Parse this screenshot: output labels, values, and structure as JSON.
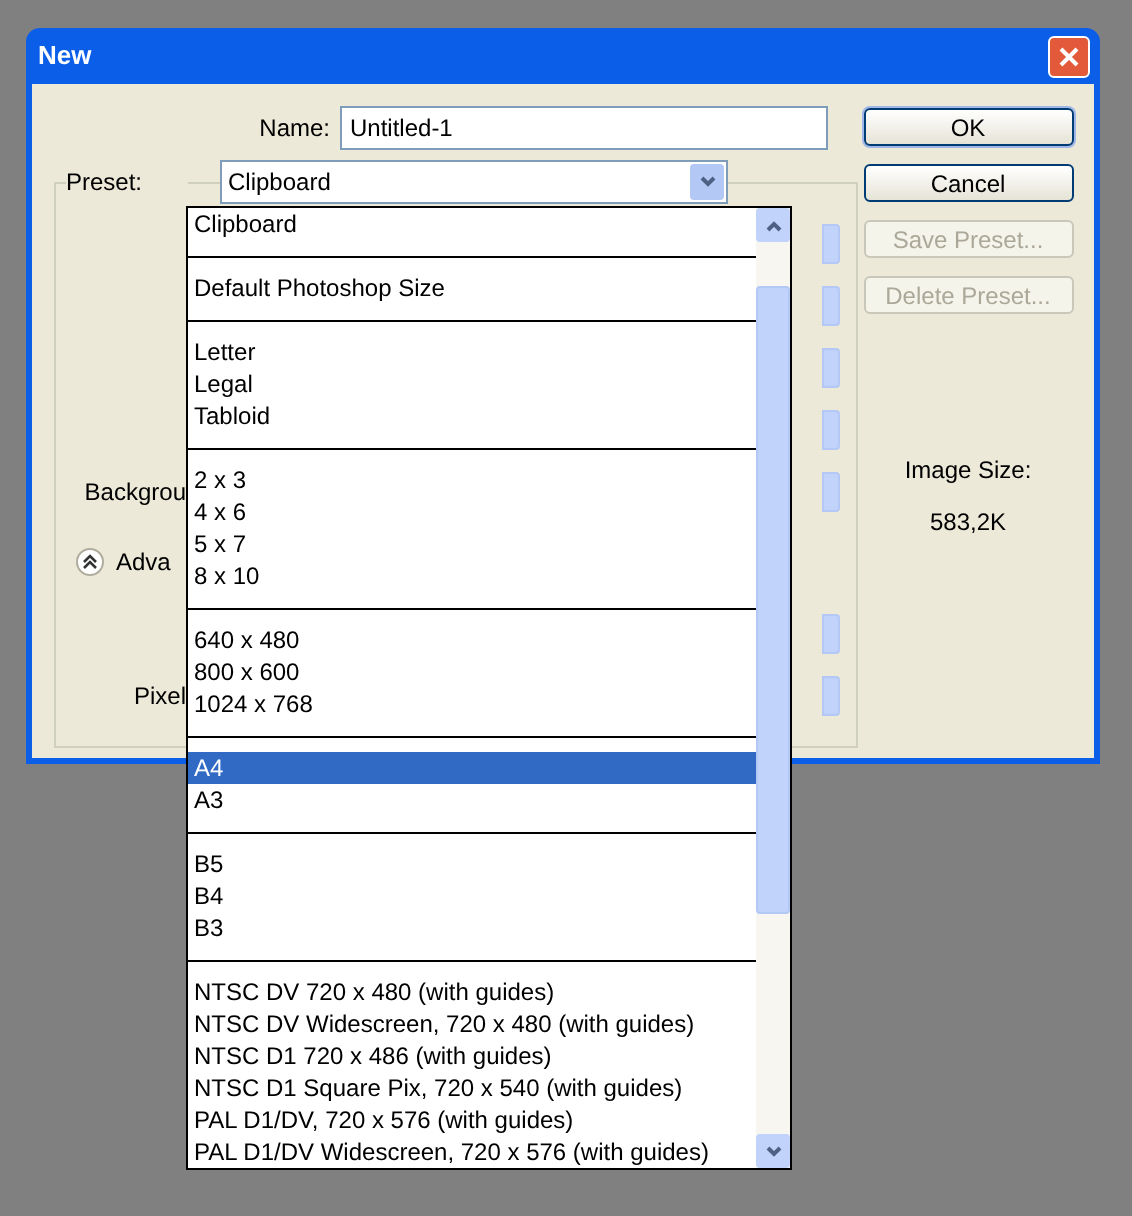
{
  "window": {
    "title": "New"
  },
  "name_field": {
    "label": "Name:",
    "value": "Untitled-1"
  },
  "preset": {
    "label": "Preset:",
    "value": "Clipboard",
    "expanded": true
  },
  "settings_rows": [
    {
      "kind": "dropdown"
    },
    {
      "kind": "dropdown"
    },
    {
      "kind": "dropdown"
    },
    {
      "kind": "dropdown"
    },
    {
      "kind": "dropdown",
      "label": "Backgrou"
    },
    {
      "kind": "advanced",
      "label": "Adva"
    },
    {
      "kind": "dropdown"
    },
    {
      "kind": "dropdown",
      "label": "Pixel"
    }
  ],
  "buttons": [
    {
      "label": "OK",
      "disabled": false,
      "default": true
    },
    {
      "label": "Cancel",
      "disabled": false,
      "default": false
    },
    {
      "label": "Save Preset...",
      "disabled": true
    },
    {
      "label": "Delete Preset...",
      "disabled": true
    }
  ],
  "image_size": {
    "label": "Image Size:",
    "value": "583,2K"
  },
  "preset_list": [
    [
      {
        "label": "Clipboard",
        "selected": false
      }
    ],
    [
      {
        "label": "Default Photoshop Size",
        "selected": false
      }
    ],
    [
      {
        "label": "Letter",
        "selected": false
      },
      {
        "label": "Legal",
        "selected": false
      },
      {
        "label": "Tabloid",
        "selected": false
      }
    ],
    [
      {
        "label": "2 x 3",
        "selected": false
      },
      {
        "label": "4 x 6",
        "selected": false
      },
      {
        "label": "5 x 7",
        "selected": false
      },
      {
        "label": "8 x 10",
        "selected": false
      }
    ],
    [
      {
        "label": "640 x 480",
        "selected": false
      },
      {
        "label": "800 x 600",
        "selected": false
      },
      {
        "label": "1024 x 768",
        "selected": false
      }
    ],
    [
      {
        "label": "A4",
        "selected": true
      },
      {
        "label": "A3",
        "selected": false
      }
    ],
    [
      {
        "label": "B5",
        "selected": false
      },
      {
        "label": "B4",
        "selected": false
      },
      {
        "label": "B3",
        "selected": false
      }
    ],
    [
      {
        "label": "NTSC DV 720 x 480 (with guides)",
        "selected": false
      },
      {
        "label": "NTSC DV Widescreen, 720 x 480 (with guides)",
        "selected": false
      },
      {
        "label": "NTSC D1 720 x 486 (with guides)",
        "selected": false
      },
      {
        "label": "NTSC D1 Square Pix, 720 x 540 (with guides)",
        "selected": false
      },
      {
        "label": "PAL D1/DV, 720 x 576 (with guides)",
        "selected": false
      },
      {
        "label": "PAL D1/DV Widescreen, 720 x 576 (with guides)",
        "selected": false
      }
    ]
  ]
}
